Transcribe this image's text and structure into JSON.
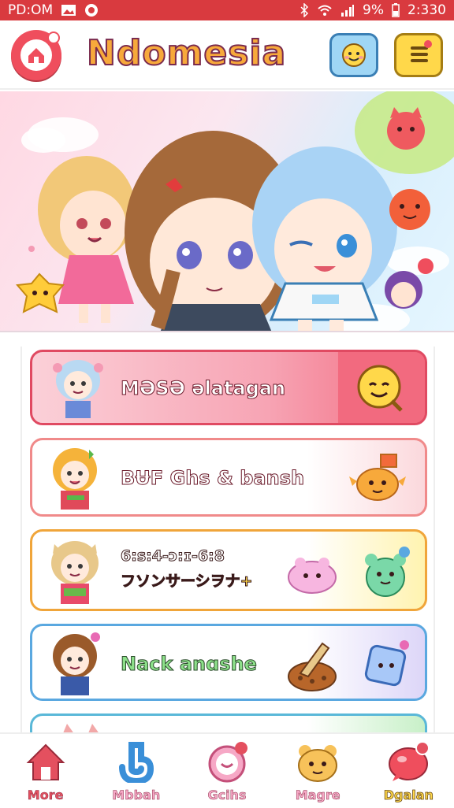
{
  "status_bar": {
    "time_left": "PD:OM",
    "battery": "9%",
    "time_right": "2:330",
    "bg_color": "#d93a3f"
  },
  "header": {
    "title": "Ndomesia",
    "logo_icon": "home-chat-icon",
    "right_buttons": [
      "emoji-face-icon",
      "menu-list-icon"
    ]
  },
  "banner": {
    "characters": [
      "blonde-girl-pink-dress",
      "brown-hair-girl-braid",
      "blue-hair-girl-winking"
    ],
    "mascots": [
      "red-cat-mascot",
      "red-blob-mascot",
      "purple-hair-girl",
      "yellow-star-mascot"
    ]
  },
  "menu_cards": [
    {
      "label": "MƏSƏ əlatagan",
      "accent": "#f26a7f",
      "icon": "yellow-smile-icon"
    },
    {
      "label": "BɄF Ghs & bansh",
      "accent": "#f08a8a",
      "icon": "orange-critter-icon"
    },
    {
      "label_line1": "6:ꜱ:4-ɔ:ɪ-6:8",
      "label_line2": "フソンサーシヲナ+",
      "accent": "#f0a53a",
      "icon": "green-bear-icon"
    },
    {
      "label": "Nack anɑshe",
      "accent": "#5aa8e0",
      "icon": "blue-cube-icon"
    }
  ],
  "tabs": [
    {
      "label": "More",
      "icon": "house-icon",
      "color": "#e4505f"
    },
    {
      "label": "Mbbah",
      "icon": "b-letter-icon",
      "color": "#f6a8c6"
    },
    {
      "label": "Gcihs",
      "icon": "smile-bubble-icon",
      "color": "#f6a8c6"
    },
    {
      "label": "Magre",
      "icon": "bear-face-icon",
      "color": "#f6a8c6"
    },
    {
      "label": "Dgalan",
      "icon": "heart-chat-icon",
      "color": "#ffd84a"
    }
  ]
}
